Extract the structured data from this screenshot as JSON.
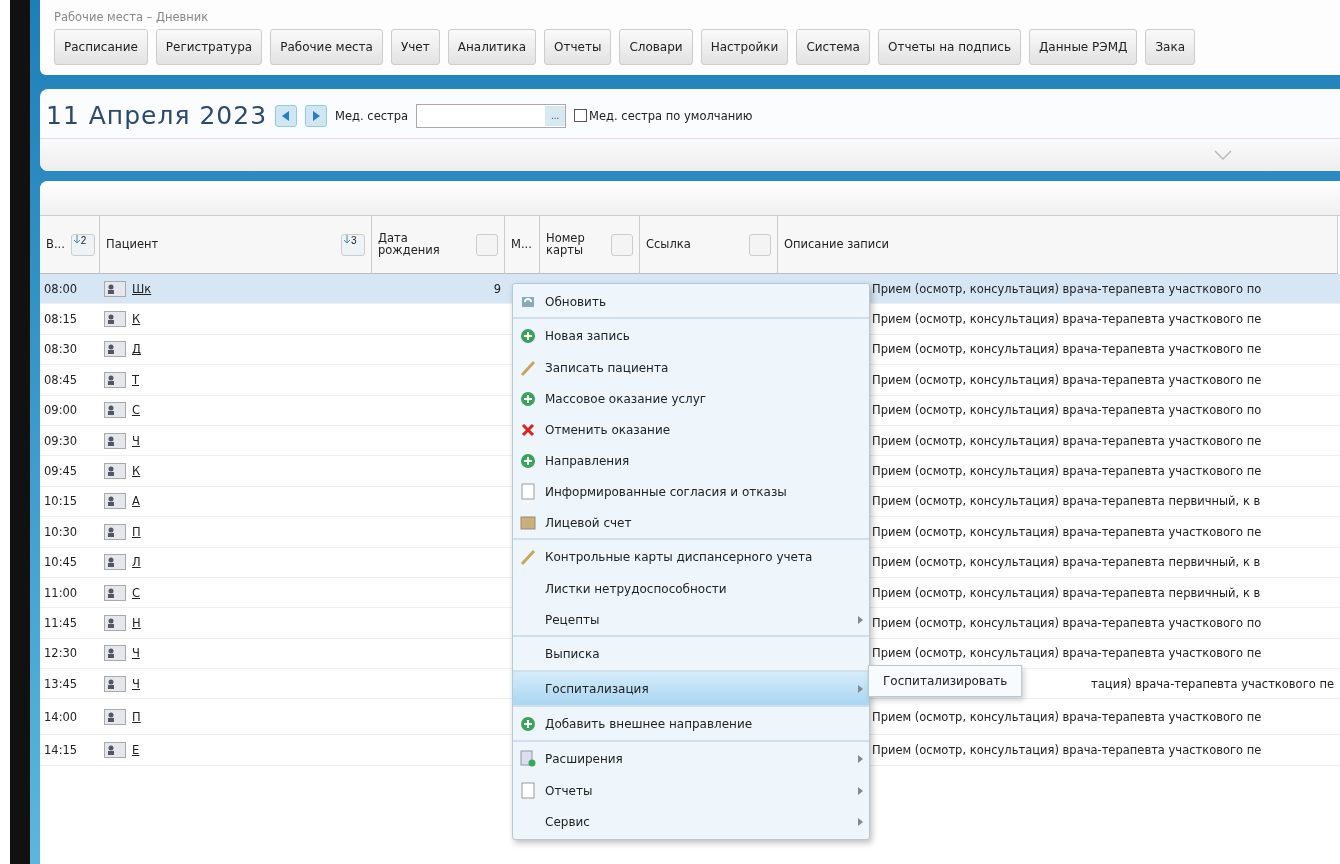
{
  "breadcrumb": "Рабочие места – Дневник",
  "nav_buttons": [
    "Расписание",
    "Регистратура",
    "Рабочие места",
    "Учет",
    "Аналитика",
    "Отчеты",
    "Словари",
    "Настройки",
    "Система",
    "Отчеты на подпись",
    "Данные РЭМД",
    "Зака"
  ],
  "date_title": "11 Апреля 2023",
  "nurse": {
    "label": "Мед. сестра",
    "button": "...",
    "default_label": "Мед. сестра по умолчанию",
    "default_checked": false
  },
  "table": {
    "columns": [
      {
        "label": "В...",
        "sort": "2"
      },
      {
        "label": "Пациент",
        "sort": "3"
      },
      {
        "label": "Дата рождения",
        "filter": true
      },
      {
        "label": "М...",
        "filter": false
      },
      {
        "label": "Номер карты",
        "filter": true
      },
      {
        "label": "Ссылка",
        "filter": true
      },
      {
        "label": "Описание записи",
        "filter": false
      }
    ],
    "rows": [
      {
        "time": "08:00",
        "patient": "Шк",
        "birth": "9",
        "description": "Прием (осмотр, консультация) врача-терапевта участкового по",
        "selected": true,
        "covered": false
      },
      {
        "time": "08:15",
        "patient": "К",
        "description": "Прием (осмотр, консультация) врача-терапевта участкового пе",
        "selected": false,
        "covered": false
      },
      {
        "time": "08:30",
        "patient": "Д",
        "description": "Прием (осмотр, консультация) врача-терапевта участкового пе",
        "selected": false,
        "covered": false
      },
      {
        "time": "08:45",
        "patient": "Т",
        "description": "Прием (осмотр, консультация) врача-терапевта участкового пе",
        "selected": false,
        "covered": false
      },
      {
        "time": "09:00",
        "patient": "С",
        "description": "Прием (осмотр, консультация) врача-терапевта участкового по",
        "selected": false,
        "covered": false
      },
      {
        "time": "09:30",
        "patient": "Ч",
        "description": "Прием (осмотр, консультация) врача-терапевта участкового пе",
        "selected": false,
        "covered": false
      },
      {
        "time": "09:45",
        "patient": "К",
        "description": "Прием (осмотр, консультация) врача-терапевта участкового пе",
        "selected": false,
        "covered": false
      },
      {
        "time": "10:15",
        "patient": "А",
        "description": "Прием (осмотр, консультация) врача-терапевта первичный, к в",
        "selected": false,
        "covered": false
      },
      {
        "time": "10:30",
        "patient": "П",
        "description": "Прием (осмотр, консультация) врача-терапевта участкового пе",
        "selected": false,
        "covered": false
      },
      {
        "time": "10:45",
        "patient": "Л",
        "description": "Прием (осмотр, консультация) врача-терапевта первичный, к в",
        "selected": false,
        "covered": false
      },
      {
        "time": "11:00",
        "patient": "С",
        "description": "Прием (осмотр, консультация) врача-терапевта первичный, к в",
        "selected": false,
        "covered": false
      },
      {
        "time": "11:45",
        "patient": "Н",
        "description": "Прием (осмотр, консультация) врача-терапевта участкового по",
        "selected": false,
        "covered": false
      },
      {
        "time": "12:30",
        "patient": "Ч",
        "description": "Прием (осмотр, консультация) врача-терапевта участкового пе",
        "selected": false,
        "covered": false
      },
      {
        "time": "13:45",
        "patient": "Ч",
        "description": "тация) врача-терапевта участкового пе",
        "selected": false,
        "covered": true
      },
      {
        "time": "14:00",
        "patient": "П",
        "description": "Прием (осмотр, консультация) врача-терапевта участкового пе",
        "selected": false,
        "covered": false
      },
      {
        "time": "14:15",
        "patient": "Е",
        "description": "Прием (осмотр, консультация) врача-терапевта участкового пе",
        "selected": false,
        "covered": false
      }
    ]
  },
  "context_menu": {
    "items": [
      {
        "label": "Обновить",
        "kind": "refresh",
        "submenu": false,
        "separator_before": false,
        "selected": false
      },
      {
        "label": "Новая запись",
        "kind": "add",
        "submenu": false,
        "separator_before": true,
        "selected": false
      },
      {
        "label": "Записать пациента",
        "kind": "edit",
        "submenu": false,
        "separator_before": false,
        "selected": false
      },
      {
        "label": "Массовое оказание услуг",
        "kind": "add",
        "submenu": false,
        "separator_before": false,
        "selected": false
      },
      {
        "label": "Отменить оказание",
        "kind": "cancel",
        "submenu": false,
        "separator_before": false,
        "selected": false
      },
      {
        "label": "Направления",
        "kind": "add",
        "submenu": false,
        "separator_before": false,
        "selected": false
      },
      {
        "label": "Информированные согласия и отказы",
        "kind": "document",
        "submenu": false,
        "separator_before": false,
        "selected": false
      },
      {
        "label": "Лицевой счет",
        "kind": "account",
        "submenu": false,
        "separator_before": false,
        "selected": false
      },
      {
        "label": "Контрольные карты диспансерного учета",
        "kind": "edit",
        "submenu": false,
        "separator_before": true,
        "selected": false
      },
      {
        "label": "Листки нетрудоспособности",
        "kind": "plain",
        "submenu": false,
        "separator_before": false,
        "selected": false
      },
      {
        "label": "Рецепты",
        "kind": "plain",
        "submenu": true,
        "separator_before": false,
        "selected": false
      },
      {
        "label": "Выписка",
        "kind": "plain",
        "submenu": false,
        "separator_before": true,
        "selected": false
      },
      {
        "label": "Госпитализация",
        "kind": "plain",
        "submenu": true,
        "separator_before": true,
        "selected": true
      },
      {
        "label": "Добавить внешнее направление",
        "kind": "add",
        "submenu": false,
        "separator_before": true,
        "selected": false
      },
      {
        "label": "Расширения",
        "kind": "extension",
        "submenu": true,
        "separator_before": true,
        "selected": false
      },
      {
        "label": "Отчеты",
        "kind": "document",
        "submenu": true,
        "separator_before": false,
        "selected": false
      },
      {
        "label": "Сервис",
        "kind": "plain",
        "submenu": true,
        "separator_before": false,
        "selected": false
      }
    ]
  },
  "submenu": {
    "items": [
      "Госпитализировать"
    ]
  }
}
